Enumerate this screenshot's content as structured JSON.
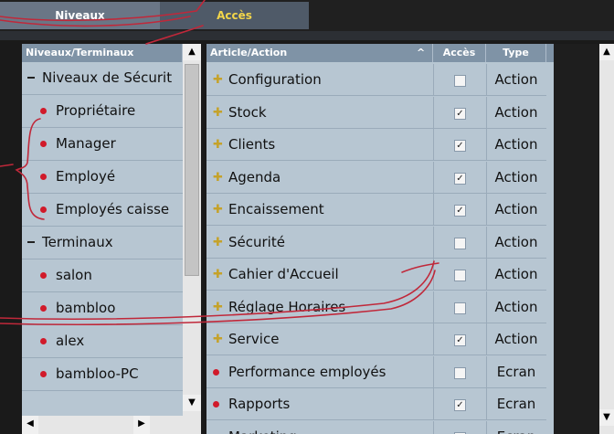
{
  "tabs": [
    {
      "label": "Niveaux"
    },
    {
      "label": "Accès"
    }
  ],
  "left": {
    "header": "Niveaux/Terminaux",
    "rows": [
      {
        "label": "Niveaux de Sécurit",
        "kind": "group"
      },
      {
        "label": "Propriétaire",
        "kind": "item"
      },
      {
        "label": "Manager",
        "kind": "item"
      },
      {
        "label": "Employé",
        "kind": "item"
      },
      {
        "label": "Employés caisse",
        "kind": "item"
      },
      {
        "label": "Terminaux",
        "kind": "group"
      },
      {
        "label": "salon",
        "kind": "item"
      },
      {
        "label": "bambloo",
        "kind": "item"
      },
      {
        "label": "alex",
        "kind": "item"
      },
      {
        "label": "bambloo-PC",
        "kind": "item"
      }
    ]
  },
  "right": {
    "headers": {
      "article": "Article/Action",
      "acces": "Accès",
      "type": "Type"
    },
    "rows": [
      {
        "label": "Configuration",
        "checked": false,
        "type": "Action",
        "marker": "plus"
      },
      {
        "label": "Stock",
        "checked": true,
        "type": "Action",
        "marker": "plus"
      },
      {
        "label": "Clients",
        "checked": true,
        "type": "Action",
        "marker": "plus"
      },
      {
        "label": "Agenda",
        "checked": true,
        "type": "Action",
        "marker": "plus"
      },
      {
        "label": "Encaissement",
        "checked": true,
        "type": "Action",
        "marker": "plus"
      },
      {
        "label": "Sécurité",
        "checked": false,
        "type": "Action",
        "marker": "plus"
      },
      {
        "label": "Cahier d'Accueil",
        "checked": false,
        "type": "Action",
        "marker": "plus"
      },
      {
        "label": "Réglage Horaires",
        "checked": false,
        "type": "Action",
        "marker": "plus"
      },
      {
        "label": "Service",
        "checked": true,
        "type": "Action",
        "marker": "plus"
      },
      {
        "label": "Performance employés",
        "checked": false,
        "type": "Ecran",
        "marker": "dot"
      },
      {
        "label": "Rapports",
        "checked": true,
        "type": "Ecran",
        "marker": "dot"
      },
      {
        "label": "Marketing",
        "checked": false,
        "type": "Ecran",
        "marker": "dot"
      }
    ]
  },
  "glyphs": {
    "check": "✓",
    "up": "▲",
    "down": "▼",
    "left": "◀",
    "right": "▶",
    "sort": "^"
  },
  "colors": {
    "annotation": "#c0283a",
    "active_tab_text": "#f2d54a"
  }
}
